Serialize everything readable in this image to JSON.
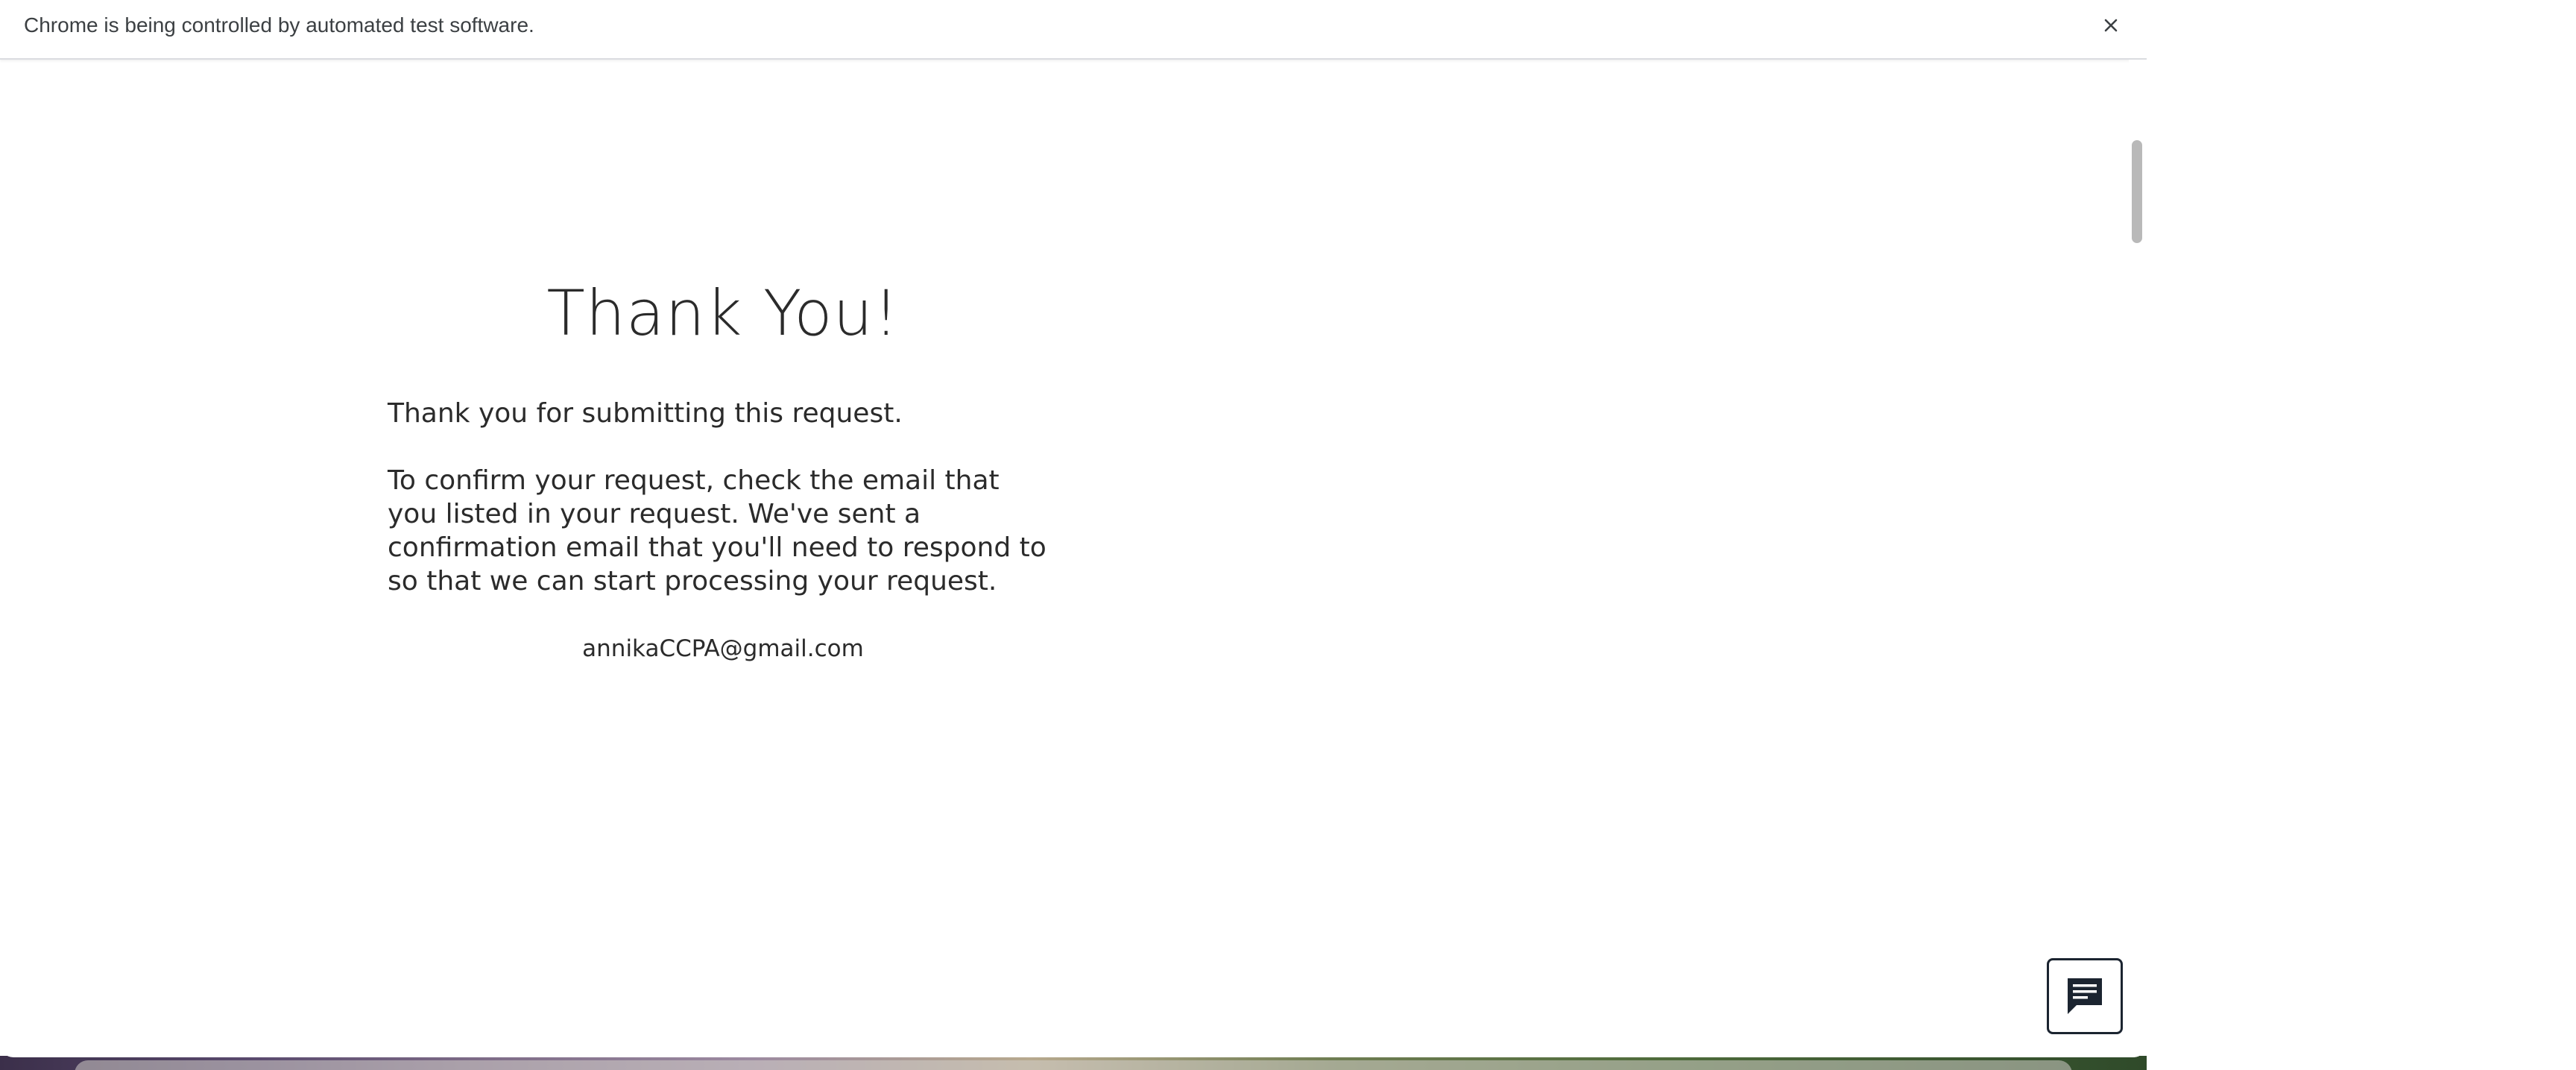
{
  "infobar": {
    "message": "Chrome is being controlled by automated test software.",
    "close_icon": "close-icon"
  },
  "page": {
    "heading": "Thank You!",
    "paragraph_1": "Thank you for submitting this request.",
    "paragraph_2": "To confirm your request, check the email that you listed in your request. We've sent a confirmation email that you'll need to respond to so that we can start processing your request.",
    "email": "annikaCCPA@gmail.com"
  },
  "chat": {
    "icon": "chat-icon"
  },
  "colors": {
    "text": "#2b2b2b",
    "infobar_text": "#3c4043",
    "chat_border": "#1b2430"
  }
}
